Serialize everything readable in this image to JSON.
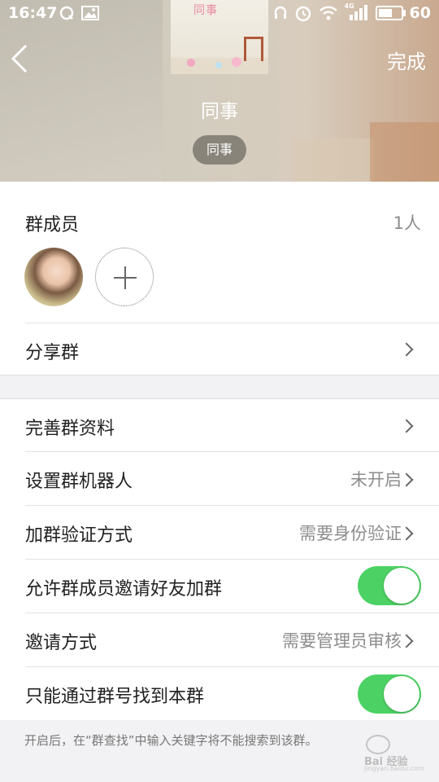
{
  "status_bar": {
    "time": "16:47",
    "battery_level": "60",
    "battery_fraction": 0.6,
    "network_label": "4G"
  },
  "header": {
    "back_icon": "chevron-left-icon",
    "done_label": "完成",
    "cover_wall_text": "同事",
    "group_name": "同事",
    "group_tag": "同事"
  },
  "members": {
    "title": "群成员",
    "count": "1人",
    "add_icon": "plus-icon"
  },
  "share": {
    "label": "分享群"
  },
  "settings": [
    {
      "label": "完善群资料",
      "value": ""
    },
    {
      "label": "设置群机器人",
      "value": "未开启"
    },
    {
      "label": "加群验证方式",
      "value": "需要身份验证"
    },
    {
      "label": "允许群成员邀请好友加群",
      "toggle": true
    },
    {
      "label": "邀请方式",
      "value": "需要管理员审核"
    },
    {
      "label": "只能通过群号找到本群",
      "toggle": true
    }
  ],
  "footnote": "开启后，在“群查找”中输入关键字将不能搜索到该群。",
  "watermark": {
    "brand": "Bai 经验",
    "sub": "jingyan.baidu.com"
  },
  "colors": {
    "toggle_on": "#4cd264",
    "chevron": "#666666"
  }
}
